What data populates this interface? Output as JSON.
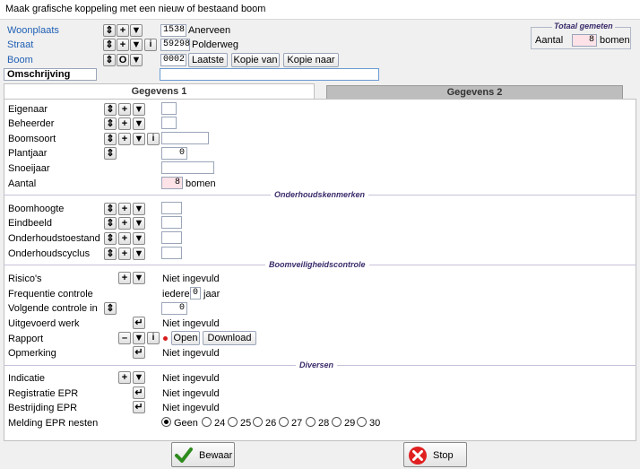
{
  "window": {
    "title": "Maak grafische koppeling met een nieuw of bestaand boom"
  },
  "header": {
    "woonplaats": {
      "label": "Woonplaats",
      "code": "1538",
      "name": "Anerveen"
    },
    "straat": {
      "label": "Straat",
      "code": "59298",
      "name": "Polderweg"
    },
    "boom": {
      "label": "Boom",
      "code": "0002",
      "btn_laatste": "Laatste",
      "btn_kopie_van": "Kopie van",
      "btn_kopie_naar": "Kopie naar"
    },
    "omschrijving": {
      "label": "Omschrijving",
      "value": ""
    }
  },
  "totaal": {
    "title": "Totaal gemeten",
    "label": "Aantal",
    "value": "8",
    "unit": "bomen"
  },
  "tabs": [
    {
      "label": "Gegevens 1"
    },
    {
      "label": "Gegevens 2"
    }
  ],
  "general": {
    "eigenaar": "Eigenaar",
    "beheerder": "Beheerder",
    "boomsoort": "Boomsoort",
    "plantjaar": {
      "label": "Plantjaar",
      "value": "0"
    },
    "snoeijaar": "Snoeijaar",
    "aantal": {
      "label": "Aantal",
      "value": "8",
      "unit": "bomen"
    }
  },
  "sections": {
    "onderhoud": "Onderhoudskenmerken",
    "veiligheid": "Boomveiligheidscontrole",
    "diversen": "Diversen"
  },
  "onderhoud": {
    "boomhoogte": "Boomhoogte",
    "eindbeeld": "Eindbeeld",
    "onderhoudstoestand": "Onderhoudstoestand",
    "onderhoudscyclus": "Onderhoudscyclus"
  },
  "veiligheid": {
    "risicos": {
      "label": "Risico's",
      "value": "Niet ingevuld"
    },
    "frequentie": {
      "label": "Frequentie controle",
      "prefix": "iedere",
      "value": "0",
      "suffix": "jaar"
    },
    "volgende": {
      "label": "Volgende controle in",
      "value": "0"
    },
    "uitgevoerd": {
      "label": "Uitgevoerd werk",
      "value": "Niet ingevuld"
    },
    "rapport": {
      "label": "Rapport",
      "btn_open": "Open",
      "btn_download": "Download"
    },
    "opmerking": {
      "label": "Opmerking",
      "value": "Niet ingevuld"
    }
  },
  "diversen": {
    "indicatie": {
      "label": "Indicatie",
      "value": "Niet ingevuld"
    },
    "registratie": {
      "label": "Registratie EPR",
      "value": "Niet ingevuld"
    },
    "bestrijding": {
      "label": "Bestrijding EPR",
      "value": "Niet ingevuld"
    },
    "melding": {
      "label": "Melding EPR nesten",
      "options": [
        "Geen",
        "24",
        "25",
        "26",
        "27",
        "28",
        "29",
        "30"
      ],
      "selected": "Geen"
    }
  },
  "footer": {
    "bewaar": "Bewaar",
    "stop": "Stop"
  },
  "colors": {
    "accent_link": "#1f5fb4",
    "rapport_dot": "#d81b1b",
    "section_text": "#3a2a6a"
  }
}
